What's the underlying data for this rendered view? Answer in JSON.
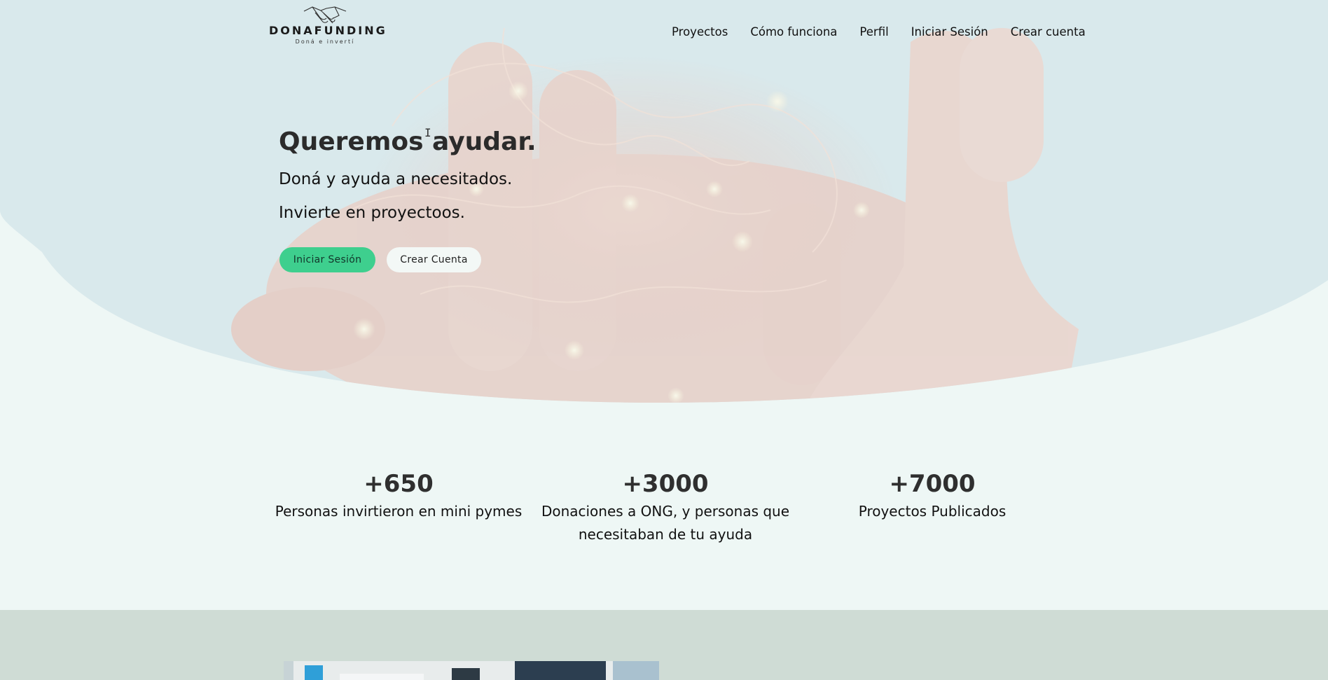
{
  "header": {
    "logo_name": "DONAFUNDING",
    "logo_tagline": "Doná e invertí",
    "nav": [
      {
        "label": "Proyectos"
      },
      {
        "label": "Cómo funciona"
      },
      {
        "label": "Perfil"
      },
      {
        "label": "Iniciar Sesión"
      },
      {
        "label": "Crear cuenta"
      }
    ]
  },
  "hero": {
    "title": "Queremos ayudar.",
    "line1": "Doná y ayuda a necesitados.",
    "line2": "Invierte en proyectoos.",
    "primary_button": "Iniciar Sesión",
    "secondary_button": "Crear Cuenta"
  },
  "stats": [
    {
      "value": "+650",
      "label": "Personas invirtieron en mini pymes"
    },
    {
      "value": "+3000",
      "label": "Donaciones a ONG, y personas que necesitaban de tu ayuda"
    },
    {
      "value": "+7000",
      "label": "Proyectos Publicados"
    }
  ],
  "colors": {
    "accent": "#3ecf8e",
    "page_background": "#eef7f5",
    "hero_sky": "#d6e7ea",
    "band": "#cfdcd5"
  }
}
